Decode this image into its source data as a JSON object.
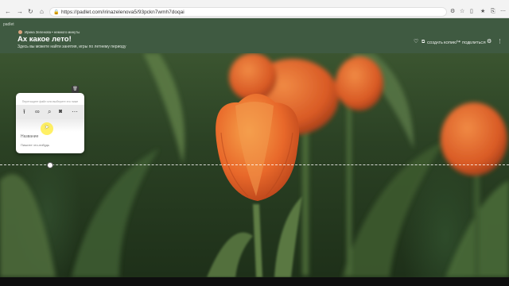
{
  "browser": {
    "url": "https://padlet.com/irinazelenova5/93pckn7wmh7doqai",
    "nav_icons": [
      "back-icon",
      "forward-icon",
      "reload-icon",
      "home-icon"
    ],
    "right_icons": [
      "settings-icon",
      "star-icon",
      "sidebar-icon",
      "favorites-icon",
      "share-icon",
      "more-icon"
    ]
  },
  "padlet": {
    "brand": "padlet",
    "author": "Ирина Зеленова",
    "time": "• немного минуты",
    "title": "Ах какое лето!",
    "subtitle": "Здесь вы можете найти занятия, игры по летнему периоду",
    "actions": {
      "create": "СОЗДАТЬ КОПИЮ",
      "share": "ПОДЕЛИТЬСЯ"
    }
  },
  "composer": {
    "hint": "Перетащите файл или выберите его ниже",
    "title_placeholder": "Название",
    "body_placeholder": "Пишите что-нибудь"
  },
  "colors": {
    "header": "#3f5a41",
    "tulip": "#e8682a",
    "highlight": "#ffeb32"
  }
}
